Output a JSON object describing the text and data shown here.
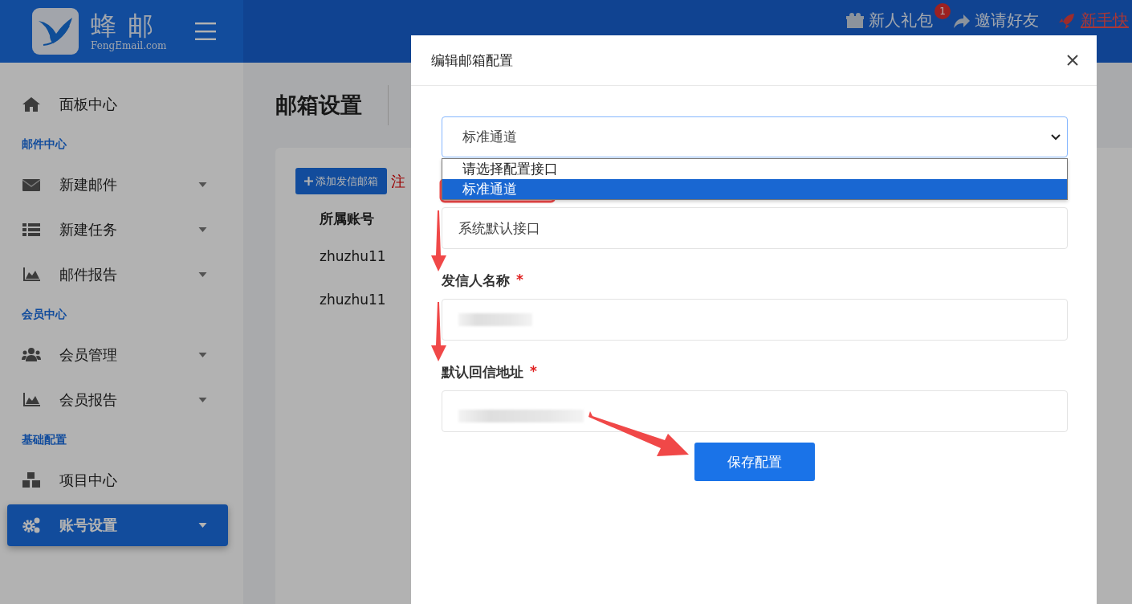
{
  "header": {
    "logo": {
      "title": "蜂 邮",
      "subtitle": "FengEmail.com"
    },
    "links": [
      {
        "kind": "gift",
        "label": "新人礼包",
        "badge": "1"
      },
      {
        "kind": "share",
        "label": "邀请好友"
      },
      {
        "kind": "rocket",
        "label": "新手快"
      }
    ]
  },
  "sidebar": {
    "items": [
      {
        "kind": "item",
        "label": "面板中心",
        "has_menu": false,
        "selected": false
      },
      {
        "kind": "section",
        "label": "邮件中心"
      },
      {
        "kind": "item",
        "label": "新建邮件",
        "has_menu": true,
        "selected": false
      },
      {
        "kind": "item",
        "label": "新建任务",
        "has_menu": true,
        "selected": false
      },
      {
        "kind": "item",
        "label": "邮件报告",
        "has_menu": true,
        "selected": false
      },
      {
        "kind": "section",
        "label": "会员中心"
      },
      {
        "kind": "item",
        "label": "会员管理",
        "has_menu": true,
        "selected": false
      },
      {
        "kind": "item",
        "label": "会员报告",
        "has_menu": true,
        "selected": false
      },
      {
        "kind": "section",
        "label": "基础配置"
      },
      {
        "kind": "item",
        "label": "项目中心",
        "has_menu": false,
        "selected": false
      },
      {
        "kind": "item",
        "label": "账号设置",
        "has_menu": true,
        "selected": true
      }
    ]
  },
  "main": {
    "title": "邮箱设置",
    "add_button": "添加发信邮箱",
    "note": "注",
    "table": {
      "columns": [
        "所属账号"
      ],
      "rows": [
        [
          "zhuzhu11"
        ],
        [
          "zhuzhu11"
        ]
      ]
    }
  },
  "modal": {
    "title": "编辑邮箱配置",
    "select": {
      "value": "标准通道",
      "options": [
        {
          "label": "请选择配置接口",
          "selected": false
        },
        {
          "label": "标准通道",
          "selected": true
        }
      ]
    },
    "fields": [
      {
        "value": "系统默认接口",
        "redacted": false
      },
      {
        "label": "发信人名称",
        "required_mark": "*",
        "redacted": true
      },
      {
        "label": "默认回信地址",
        "required_mark": "*",
        "redacted": true
      }
    ],
    "save_button": "保存配置"
  }
}
